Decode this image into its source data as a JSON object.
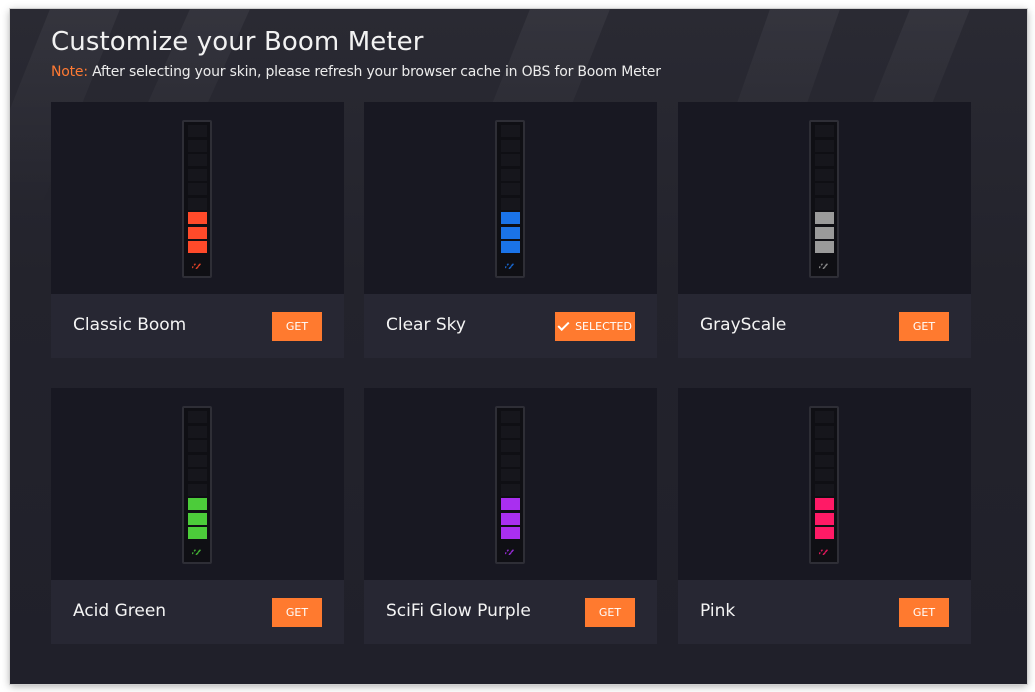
{
  "page": {
    "title": "Customize your Boom Meter",
    "note_label": "Note:",
    "note_text": " After selecting your skin, please refresh your browser cache in OBS for Boom Meter"
  },
  "skins": [
    {
      "name": "Classic Boom",
      "button": "GET",
      "selected": false,
      "color": "#ff4a2a"
    },
    {
      "name": "Clear Sky",
      "button": "SELECTED",
      "selected": true,
      "color": "#1a73e8"
    },
    {
      "name": "GrayScale",
      "button": "GET",
      "selected": false,
      "color": "#9a9a9a"
    },
    {
      "name": "Acid Green",
      "button": "GET",
      "selected": false,
      "color": "#4ccc3a"
    },
    {
      "name": "SciFi Glow Purple",
      "button": "GET",
      "selected": false,
      "color": "#a92ff0"
    },
    {
      "name": "Pink",
      "button": "GET",
      "selected": false,
      "color": "#ff1a66"
    }
  ],
  "meter": {
    "total_segments": 9,
    "lit_segments": 3
  },
  "colors": {
    "accent": "#ff7a2f",
    "note": "#ff7a33"
  }
}
